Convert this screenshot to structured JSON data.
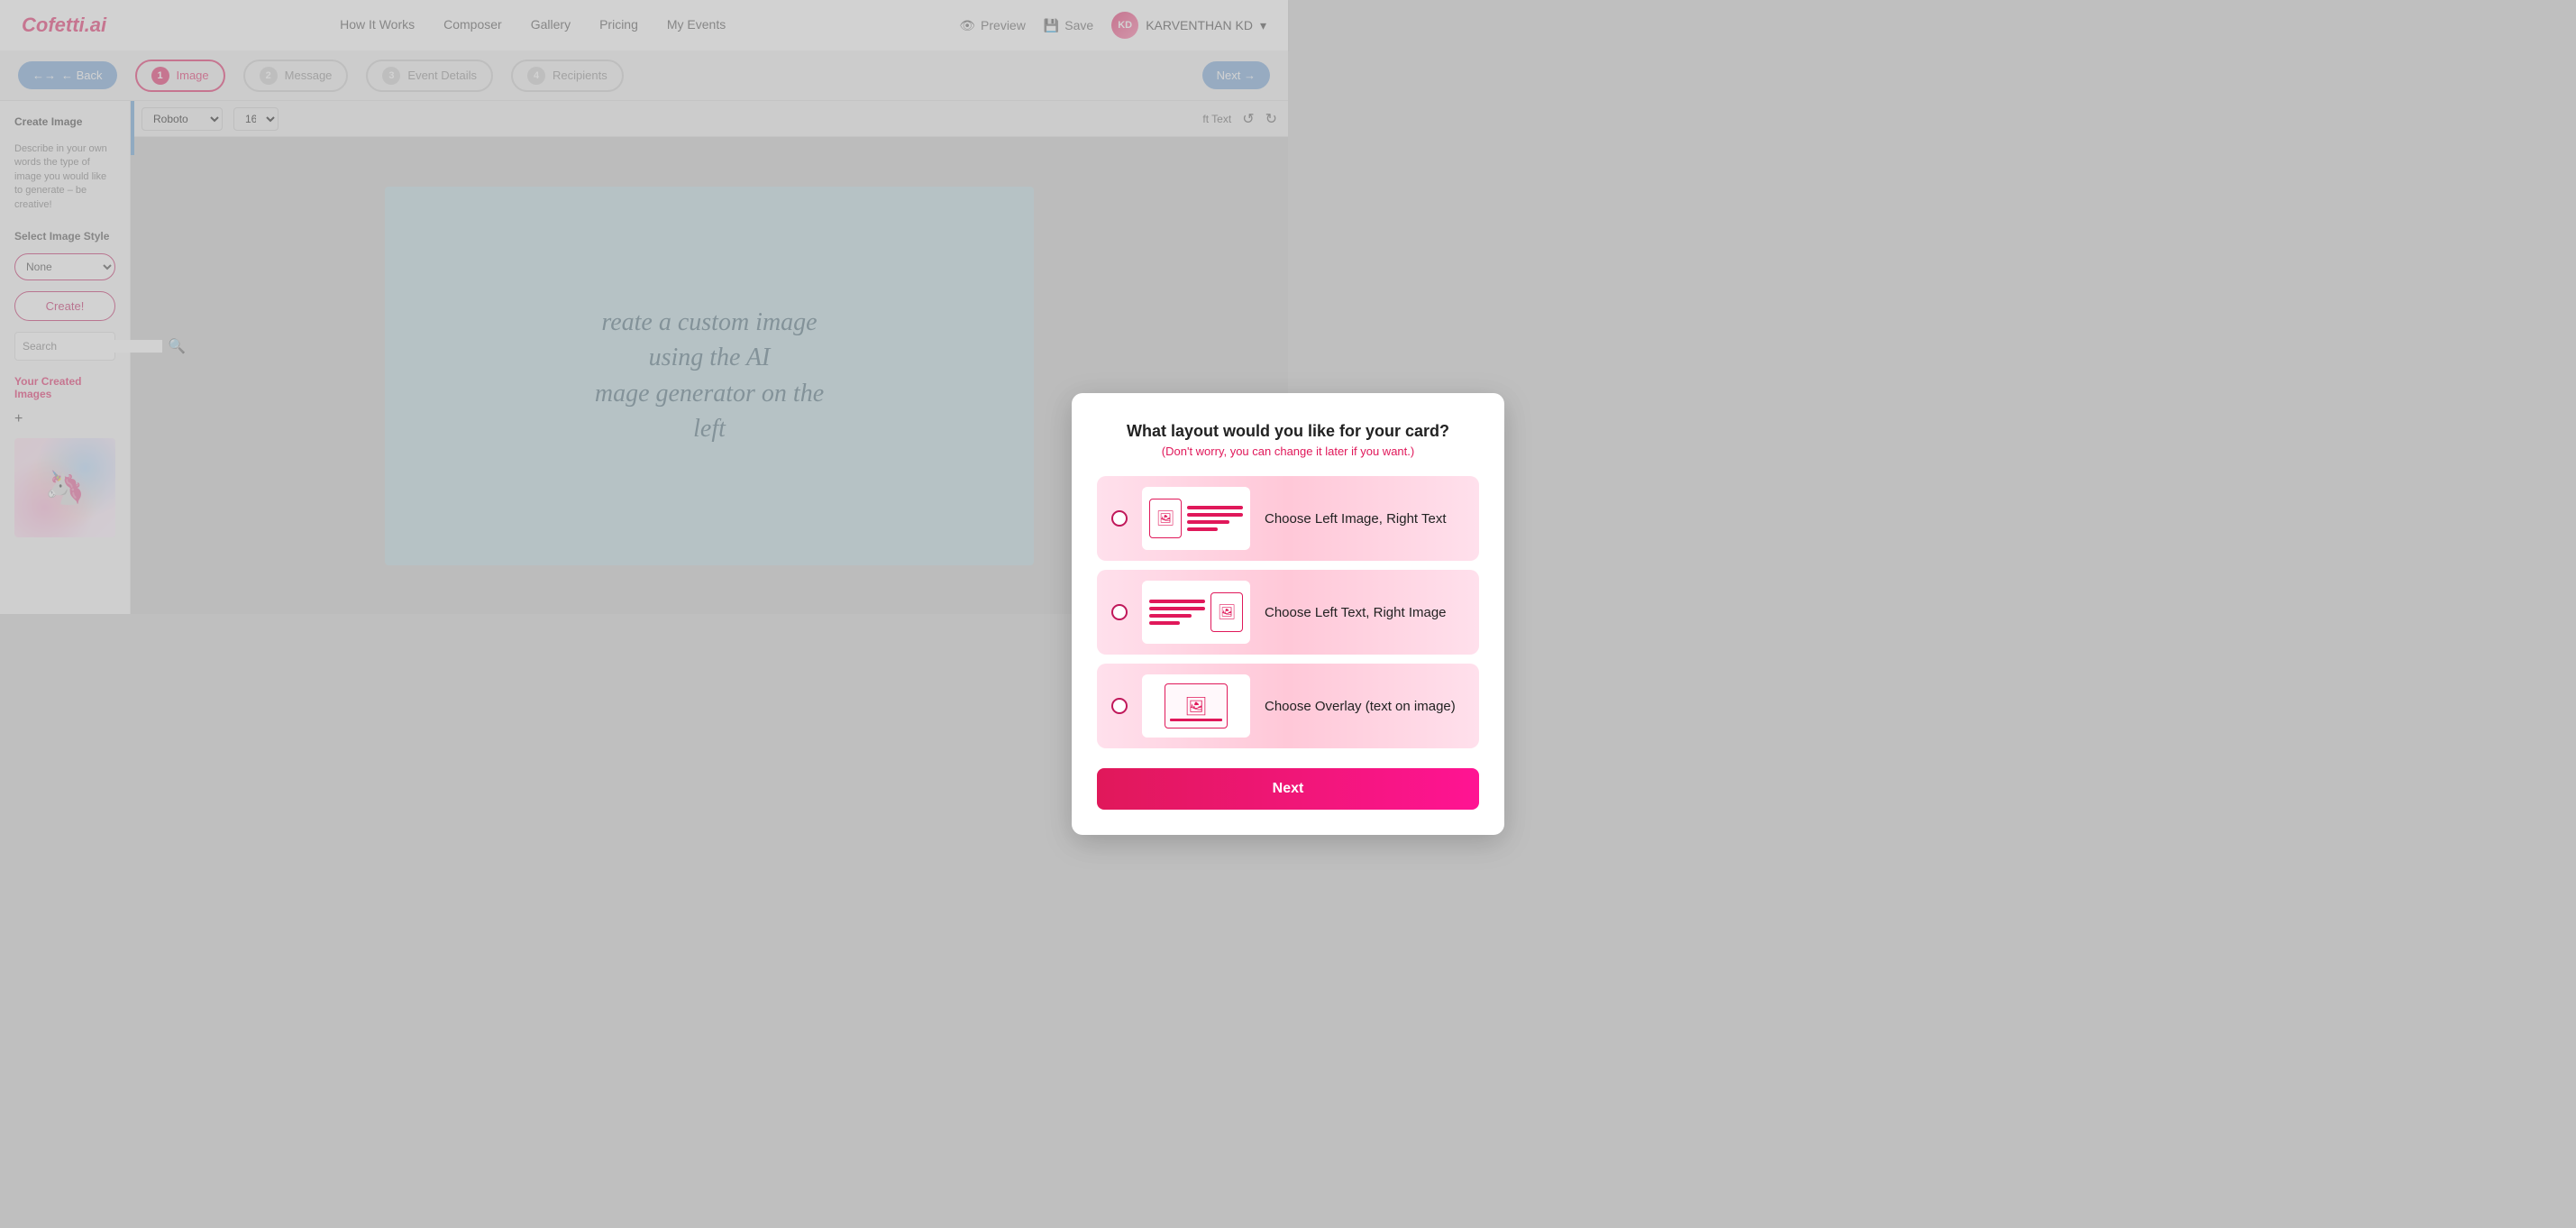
{
  "app": {
    "name": "Cofetti.ai"
  },
  "navbar": {
    "logo": "Cofetti.ai",
    "links": [
      {
        "label": "How It Works",
        "id": "how-it-works"
      },
      {
        "label": "Composer",
        "id": "composer"
      },
      {
        "label": "Gallery",
        "id": "gallery"
      },
      {
        "label": "Pricing",
        "id": "pricing"
      },
      {
        "label": "My Events",
        "id": "my-events"
      }
    ],
    "preview_label": "Preview",
    "save_label": "Save",
    "user_name": "KARVENTHAN KD",
    "user_initials": "KD"
  },
  "steps_bar": {
    "back_label": "← Back",
    "next_label": "Next →",
    "steps": [
      {
        "number": "1",
        "label": "Image",
        "active": true
      },
      {
        "number": "2",
        "label": "Message",
        "active": false
      },
      {
        "number": "3",
        "label": "Event Details",
        "active": false
      },
      {
        "number": "4",
        "label": "Recipients",
        "active": false
      }
    ]
  },
  "sidebar": {
    "create_image_title": "Create Image",
    "create_image_desc": "Describe in your own words the type of image you would like to generate – be creative!",
    "select_style_label": "Select Image Style",
    "style_default": "None",
    "create_btn_label": "Create!",
    "search_placeholder": "Search",
    "your_images_title": "Your Created Images"
  },
  "toolbar": {
    "font_default": "Roboto",
    "size_default": "16",
    "text_label": "ft Text",
    "undo_icon": "↺",
    "redo_icon": "↻"
  },
  "card_preview": {
    "text_line1": "reate a custom image",
    "text_line2": "using the AI",
    "text_line3": "mage generator on the",
    "text_line4": "left"
  },
  "modal": {
    "title": "What layout would you like for your card?",
    "subtitle": "(Don't worry, you can change it later if you want.)",
    "options": [
      {
        "id": "left-image-right-text",
        "label": "Choose Left Image, Right Text",
        "selected": false
      },
      {
        "id": "left-text-right-image",
        "label": "Choose Left Text, Right Image",
        "selected": false
      },
      {
        "id": "overlay",
        "label": "Choose Overlay (text on image)",
        "selected": false
      }
    ],
    "next_btn_label": "Next"
  }
}
